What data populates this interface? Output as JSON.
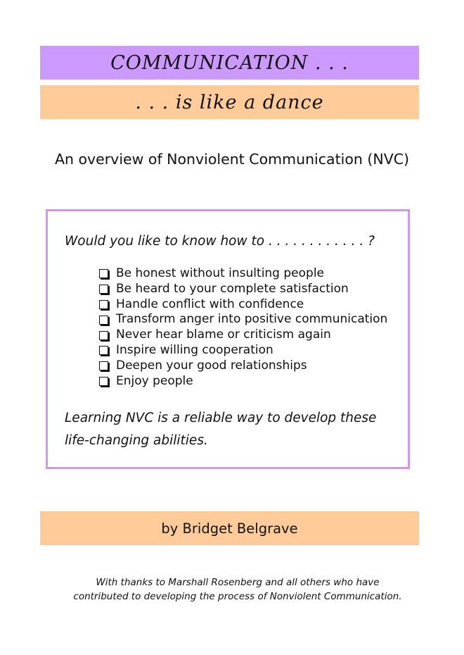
{
  "header": {
    "title": "COMMUNICATION . . .",
    "subtitle": ". . . is like a dance"
  },
  "overview": "An overview of Nonviolent Communication (NVC)",
  "box": {
    "question": "Would you like to know how to . . . . . . . . . . . . ?",
    "items": [
      "Be honest without insulting people",
      "Be heard to your complete satisfaction",
      "Handle conflict with confidence",
      "Transform anger into positive communication",
      "Never hear blame or criticism again",
      "Inspire willing cooperation",
      "Deepen your good relationships",
      "Enjoy people"
    ],
    "conclusion_line1": "Learning NVC is a reliable way to develop these",
    "conclusion_line2": "life-changing abilities."
  },
  "author": "by Bridget Belgrave",
  "thanks": {
    "line1": "With thanks to Marshall Rosenberg and all others who have",
    "line2": "contributed to developing the process of Nonviolent Communication."
  },
  "colors": {
    "lavender": "#cc99ff",
    "peach": "#ffcc99",
    "box_border": "#cc99ee"
  }
}
